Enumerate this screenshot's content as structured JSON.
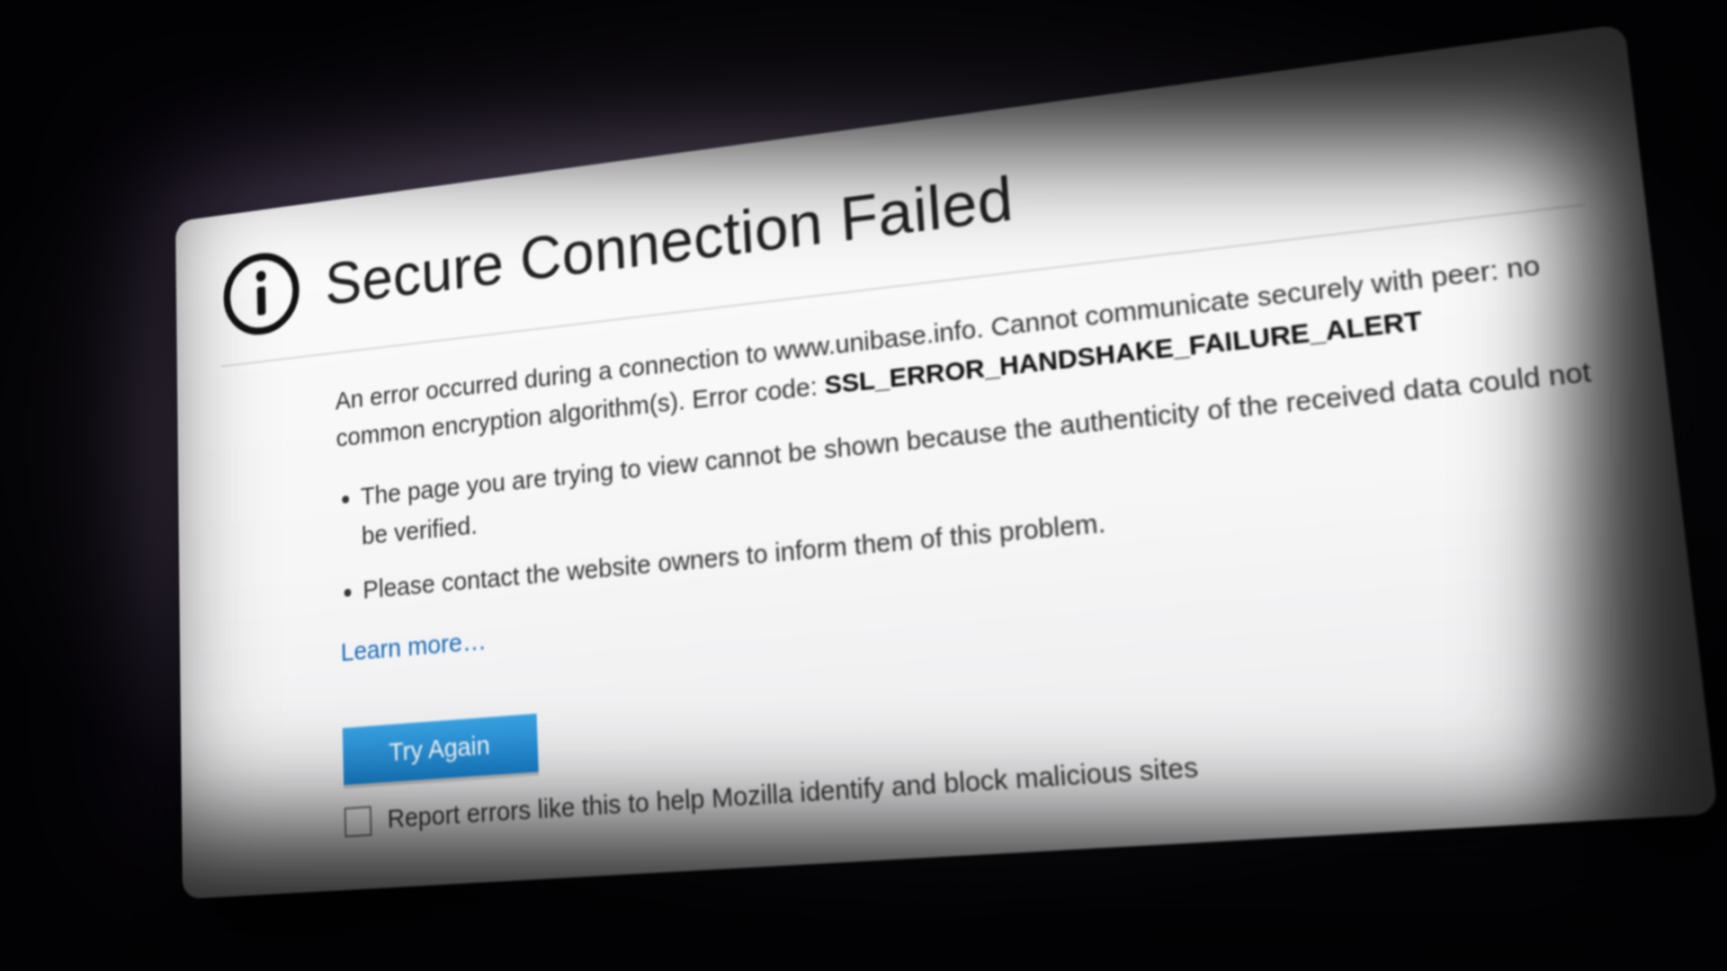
{
  "error": {
    "title": "Secure Connection Failed",
    "description_prefix": "An error occurred during a connection to www.unibase.info. Cannot communicate securely with peer: no common encryption algorithm(s). Error code: ",
    "error_code": "SSL_ERROR_HANDSHAKE_FAILURE_ALERT",
    "bullets": [
      "The page you are trying to view cannot be shown because the authenticity of the received data could not be verified.",
      "Please contact the website owners to inform them of this problem."
    ],
    "learn_more": "Learn more…",
    "try_again": "Try Again",
    "report_label": "Report errors like this to help Mozilla identify and block malicious sites"
  },
  "colors": {
    "accent_blue": "#1a84d1",
    "link_blue": "#1668b3"
  }
}
